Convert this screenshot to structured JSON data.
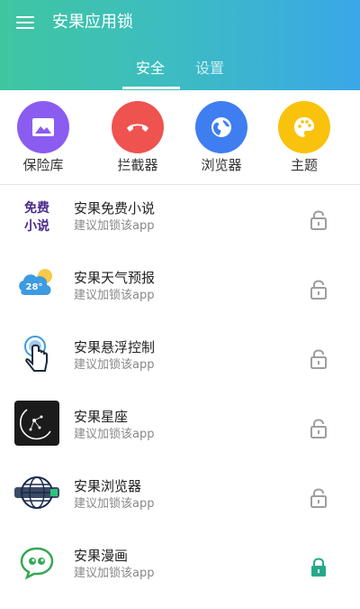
{
  "header": {
    "title": "安果应用锁",
    "tabs": [
      {
        "label": "安全"
      },
      {
        "label": "设置"
      }
    ]
  },
  "quick_actions": [
    {
      "label": "保险库",
      "icon": "image-icon",
      "color": "#8b5cf0"
    },
    {
      "label": "拦截器",
      "icon": "phone-hangup-icon",
      "color": "#ef5350"
    },
    {
      "label": "浏览器",
      "icon": "globe-icon",
      "color": "#3f7ef0"
    },
    {
      "label": "主题",
      "icon": "palette-icon",
      "color": "#f9c20c"
    }
  ],
  "apps": [
    {
      "name": "安果免费小说",
      "subtitle": "建议加锁该app",
      "icon": "free-novel-icon",
      "icon_text": "免费小说",
      "locked": false
    },
    {
      "name": "安果天气预报",
      "subtitle": "建议加锁该app",
      "icon": "weather-icon",
      "icon_text": "28°",
      "locked": false
    },
    {
      "name": "安果悬浮控制",
      "subtitle": "建议加锁该app",
      "icon": "touch-hand-icon",
      "locked": false
    },
    {
      "name": "安果星座",
      "subtitle": "建议加锁该app",
      "icon": "constellation-icon",
      "locked": false
    },
    {
      "name": "安果浏览器",
      "subtitle": "建议加锁该app",
      "icon": "globe-browser-icon",
      "locked": false
    },
    {
      "name": "安果漫画",
      "subtitle": "建议加锁该app",
      "icon": "comic-chat-icon",
      "locked": true
    }
  ],
  "colors": {
    "unlocked": "#9e9e9e",
    "locked": "#26a98a",
    "header_start": "#3fc6a0",
    "header_end": "#3aa7e8"
  }
}
